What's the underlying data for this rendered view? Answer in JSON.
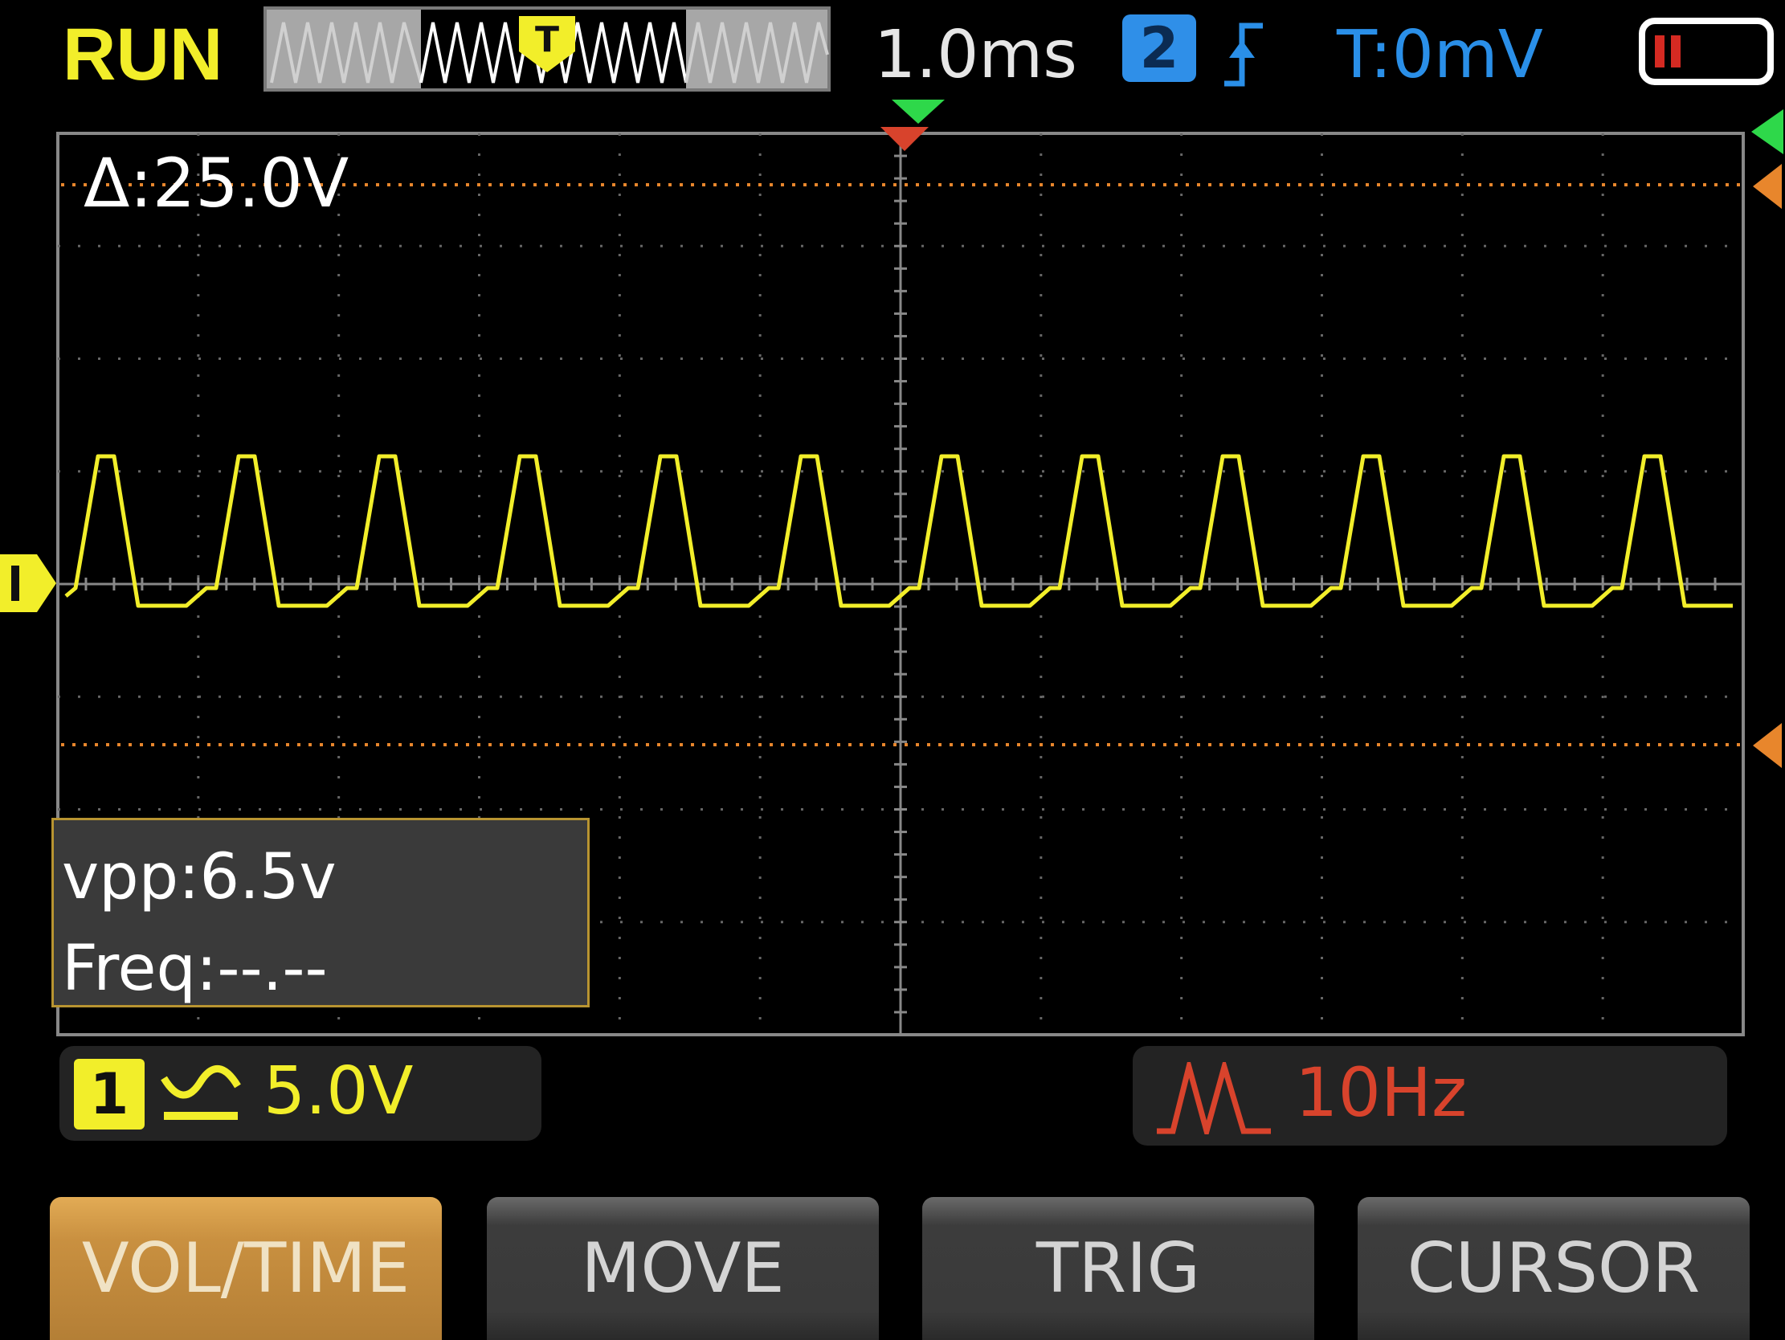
{
  "status": {
    "run_state": "RUN",
    "timebase": "1.0ms",
    "trigger_channel": "2",
    "trigger_edge_icon": "rising-edge-icon",
    "trigger_level": "T:0mV",
    "battery_icon": "battery-low-icon"
  },
  "overview": {
    "trigger_marker": "T"
  },
  "screen": {
    "cursor_delta": "Δ:25.0V",
    "channel_marker": "1"
  },
  "measurements": {
    "vpp": "vpp:6.5v",
    "freq": "Freq:--.--"
  },
  "channel_info": {
    "channel": "1",
    "coupling_icon": "ac-coupling-icon",
    "volts_per_div": "5.0V"
  },
  "signal_info": {
    "wave_icon": "waveform-icon",
    "frequency": "10Hz"
  },
  "softkeys": {
    "vol_time": "VOL/TIME",
    "move": "MOVE",
    "trig": "TRIG",
    "cursor": "CURSOR"
  },
  "colors": {
    "channel1": "#f2ee2a",
    "channel2": "#2f8fe8",
    "cursor": "#e8862c",
    "trigger_time": "#d8432c",
    "active_key": "#c99040"
  }
}
